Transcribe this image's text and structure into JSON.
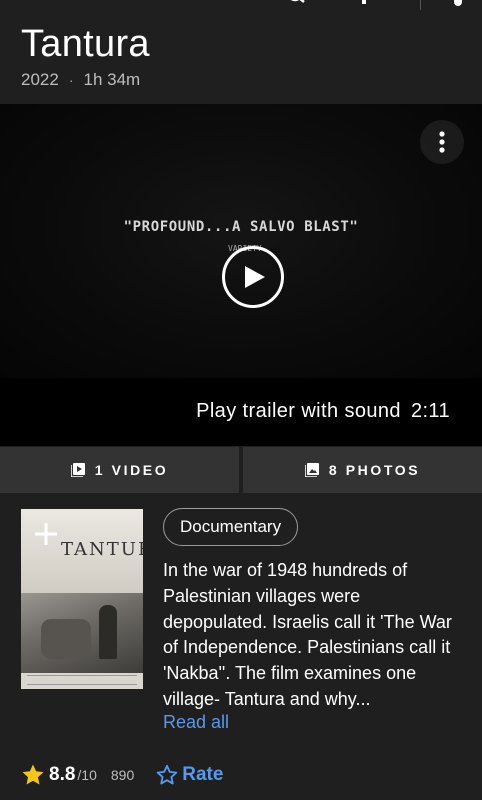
{
  "header": {
    "icons": [
      "search-icon",
      "share-icon",
      "more-icon"
    ]
  },
  "movie": {
    "title": "Tantura",
    "year": "2022",
    "separator": "·",
    "runtime": "1h 34m"
  },
  "video": {
    "quote": "\"PROFOUND...A SALVO BLAST\"",
    "quote_source": "VARIETY",
    "trailer_label": "Play trailer with sound",
    "trailer_duration": "2:11"
  },
  "media": {
    "videos_label": "1 VIDEO",
    "photos_label": "8 PHOTOS"
  },
  "poster": {
    "title_text": "TANTURA"
  },
  "details": {
    "genre": "Documentary",
    "plot": "In the war of 1948 hundreds of Palestinian villages were depopulated. Israelis call it 'The War of Independence. Palestinians call it 'Nakba''. The film examines one village- Tantura and why...",
    "read_all": "Read all"
  },
  "rating": {
    "score": "8.8",
    "out_of": "/10",
    "count": "890",
    "rate_label": "Rate"
  },
  "colors": {
    "background": "#1f1f1f",
    "accent_blue": "#5799ef",
    "star_yellow": "#f5c518",
    "button_gray": "#333333"
  }
}
